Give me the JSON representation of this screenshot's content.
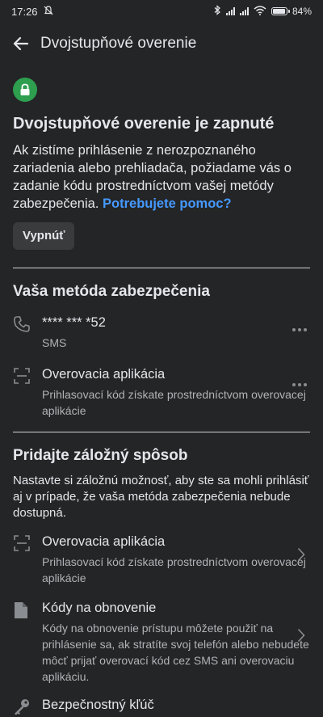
{
  "status_bar": {
    "time": "17:26",
    "battery": "84%",
    "battery_level": 0.84
  },
  "header": {
    "title": "Dvojstupňové overenie"
  },
  "hero": {
    "title": "Dvojstupňové overenie je zapnuté",
    "description": "Ak zistíme prihlásenie z nerozpoznaného zariadenia alebo prehliadača, požiadame vás o zadanie kódu prostredníctvom vašej metódy zabezpečenia.",
    "help_link": "Potrebujete pomoc?",
    "off_button": "Vypnúť"
  },
  "security_method": {
    "title": "Vaša metóda zabezpečenia",
    "items": [
      {
        "title": "**** *** *52",
        "subtitle": "SMS",
        "icon": "phone-icon"
      },
      {
        "title": "Overovacia aplikácia",
        "subtitle": "Prihlasovací kód získate prostredníctvom overovacej aplikácie",
        "icon": "qr-scan-icon"
      }
    ]
  },
  "backup": {
    "title": "Pridajte záložný spôsob",
    "intro": "Nastavte si záložnú možnosť, aby ste sa mohli prihlásiť aj v prípade, že vaša metóda zabezpečenia nebude dostupná.",
    "items": [
      {
        "title": "Overovacia aplikácia",
        "subtitle": "Prihlasovací kód získate prostredníctvom overovacej aplikácie",
        "icon": "qr-scan-icon"
      },
      {
        "title": "Kódy na obnovenie",
        "subtitle": "Kódy na obnovenie prístupu môžete použiť na prihlásenie sa, ak stratíte svoj telefón alebo nebudete môcť prijať overovací kód cez SMS ani overovaciu aplikáciu.",
        "icon": "document-icon"
      },
      {
        "title": "Bezpečnostný kľúč",
        "subtitle": "",
        "icon": "key-icon"
      }
    ]
  },
  "colors": {
    "background": "#242526",
    "accent_link": "#4599ff",
    "lock_green": "#2e9e4f"
  }
}
